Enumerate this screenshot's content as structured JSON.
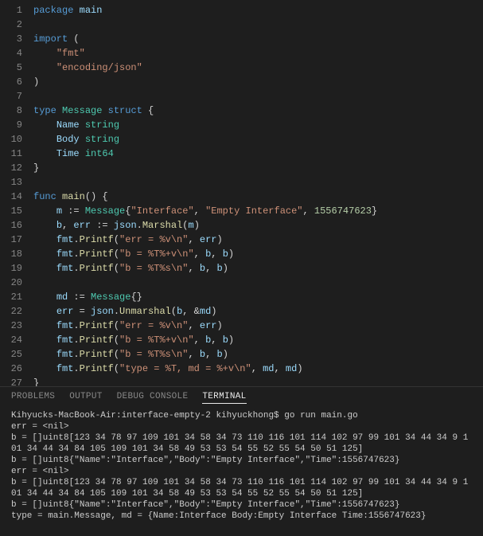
{
  "editor": {
    "lines": [
      {
        "n": 1,
        "tokens": [
          [
            "kw",
            "package"
          ],
          [
            "punc",
            " "
          ],
          [
            "pkg",
            "main"
          ]
        ]
      },
      {
        "n": 2,
        "tokens": []
      },
      {
        "n": 3,
        "tokens": [
          [
            "kw",
            "import"
          ],
          [
            "punc",
            " ("
          ]
        ]
      },
      {
        "n": 4,
        "tokens": [
          [
            "punc",
            "    "
          ],
          [
            "str",
            "\"fmt\""
          ]
        ]
      },
      {
        "n": 5,
        "tokens": [
          [
            "punc",
            "    "
          ],
          [
            "str",
            "\"encoding/json\""
          ]
        ]
      },
      {
        "n": 6,
        "tokens": [
          [
            "punc",
            ")"
          ]
        ]
      },
      {
        "n": 7,
        "tokens": []
      },
      {
        "n": 8,
        "tokens": [
          [
            "kw",
            "type"
          ],
          [
            "punc",
            " "
          ],
          [
            "type",
            "Message"
          ],
          [
            "punc",
            " "
          ],
          [
            "kw",
            "struct"
          ],
          [
            "punc",
            " {"
          ]
        ]
      },
      {
        "n": 9,
        "tokens": [
          [
            "punc",
            "    "
          ],
          [
            "var",
            "Name"
          ],
          [
            "punc",
            " "
          ],
          [
            "typekw",
            "string"
          ]
        ]
      },
      {
        "n": 10,
        "tokens": [
          [
            "punc",
            "    "
          ],
          [
            "var",
            "Body"
          ],
          [
            "punc",
            " "
          ],
          [
            "typekw",
            "string"
          ]
        ]
      },
      {
        "n": 11,
        "tokens": [
          [
            "punc",
            "    "
          ],
          [
            "var",
            "Time"
          ],
          [
            "punc",
            " "
          ],
          [
            "typekw",
            "int64"
          ]
        ]
      },
      {
        "n": 12,
        "tokens": [
          [
            "punc",
            "}"
          ]
        ]
      },
      {
        "n": 13,
        "tokens": []
      },
      {
        "n": 14,
        "tokens": [
          [
            "kw",
            "func"
          ],
          [
            "punc",
            " "
          ],
          [
            "fn",
            "main"
          ],
          [
            "punc",
            "() {"
          ]
        ]
      },
      {
        "n": 15,
        "tokens": [
          [
            "punc",
            "    "
          ],
          [
            "var",
            "m"
          ],
          [
            "punc",
            " := "
          ],
          [
            "type",
            "Message"
          ],
          [
            "punc",
            "{"
          ],
          [
            "str",
            "\"Interface\""
          ],
          [
            "punc",
            ", "
          ],
          [
            "str",
            "\"Empty Interface\""
          ],
          [
            "punc",
            ", "
          ],
          [
            "num",
            "1556747623"
          ],
          [
            "punc",
            "}"
          ]
        ]
      },
      {
        "n": 16,
        "tokens": [
          [
            "punc",
            "    "
          ],
          [
            "var",
            "b"
          ],
          [
            "punc",
            ", "
          ],
          [
            "var",
            "err"
          ],
          [
            "punc",
            " := "
          ],
          [
            "pkg",
            "json"
          ],
          [
            "punc",
            "."
          ],
          [
            "fn",
            "Marshal"
          ],
          [
            "punc",
            "("
          ],
          [
            "var",
            "m"
          ],
          [
            "punc",
            ")"
          ]
        ]
      },
      {
        "n": 17,
        "tokens": [
          [
            "punc",
            "    "
          ],
          [
            "pkg",
            "fmt"
          ],
          [
            "punc",
            "."
          ],
          [
            "fn",
            "Printf"
          ],
          [
            "punc",
            "("
          ],
          [
            "str",
            "\"err = %v\\n\""
          ],
          [
            "punc",
            ", "
          ],
          [
            "var",
            "err"
          ],
          [
            "punc",
            ")"
          ]
        ]
      },
      {
        "n": 18,
        "tokens": [
          [
            "punc",
            "    "
          ],
          [
            "pkg",
            "fmt"
          ],
          [
            "punc",
            "."
          ],
          [
            "fn",
            "Printf"
          ],
          [
            "punc",
            "("
          ],
          [
            "str",
            "\"b = %T%+v\\n\""
          ],
          [
            "punc",
            ", "
          ],
          [
            "var",
            "b"
          ],
          [
            "punc",
            ", "
          ],
          [
            "var",
            "b"
          ],
          [
            "punc",
            ")"
          ]
        ]
      },
      {
        "n": 19,
        "tokens": [
          [
            "punc",
            "    "
          ],
          [
            "pkg",
            "fmt"
          ],
          [
            "punc",
            "."
          ],
          [
            "fn",
            "Printf"
          ],
          [
            "punc",
            "("
          ],
          [
            "str",
            "\"b = %T%s\\n\""
          ],
          [
            "punc",
            ", "
          ],
          [
            "var",
            "b"
          ],
          [
            "punc",
            ", "
          ],
          [
            "var",
            "b"
          ],
          [
            "punc",
            ")"
          ]
        ]
      },
      {
        "n": 20,
        "tokens": []
      },
      {
        "n": 21,
        "tokens": [
          [
            "punc",
            "    "
          ],
          [
            "var",
            "md"
          ],
          [
            "punc",
            " := "
          ],
          [
            "type",
            "Message"
          ],
          [
            "punc",
            "{}"
          ]
        ]
      },
      {
        "n": 22,
        "tokens": [
          [
            "punc",
            "    "
          ],
          [
            "var",
            "err"
          ],
          [
            "punc",
            " = "
          ],
          [
            "pkg",
            "json"
          ],
          [
            "punc",
            "."
          ],
          [
            "fn",
            "Unmarshal"
          ],
          [
            "punc",
            "("
          ],
          [
            "var",
            "b"
          ],
          [
            "punc",
            ", &"
          ],
          [
            "var",
            "md"
          ],
          [
            "punc",
            ")"
          ]
        ]
      },
      {
        "n": 23,
        "tokens": [
          [
            "punc",
            "    "
          ],
          [
            "pkg",
            "fmt"
          ],
          [
            "punc",
            "."
          ],
          [
            "fn",
            "Printf"
          ],
          [
            "punc",
            "("
          ],
          [
            "str",
            "\"err = %v\\n\""
          ],
          [
            "punc",
            ", "
          ],
          [
            "var",
            "err"
          ],
          [
            "punc",
            ")"
          ]
        ]
      },
      {
        "n": 24,
        "tokens": [
          [
            "punc",
            "    "
          ],
          [
            "pkg",
            "fmt"
          ],
          [
            "punc",
            "."
          ],
          [
            "fn",
            "Printf"
          ],
          [
            "punc",
            "("
          ],
          [
            "str",
            "\"b = %T%+v\\n\""
          ],
          [
            "punc",
            ", "
          ],
          [
            "var",
            "b"
          ],
          [
            "punc",
            ", "
          ],
          [
            "var",
            "b"
          ],
          [
            "punc",
            ")"
          ]
        ]
      },
      {
        "n": 25,
        "tokens": [
          [
            "punc",
            "    "
          ],
          [
            "pkg",
            "fmt"
          ],
          [
            "punc",
            "."
          ],
          [
            "fn",
            "Printf"
          ],
          [
            "punc",
            "("
          ],
          [
            "str",
            "\"b = %T%s\\n\""
          ],
          [
            "punc",
            ", "
          ],
          [
            "var",
            "b"
          ],
          [
            "punc",
            ", "
          ],
          [
            "var",
            "b"
          ],
          [
            "punc",
            ")"
          ]
        ]
      },
      {
        "n": 26,
        "tokens": [
          [
            "punc",
            "    "
          ],
          [
            "pkg",
            "fmt"
          ],
          [
            "punc",
            "."
          ],
          [
            "fn",
            "Printf"
          ],
          [
            "punc",
            "("
          ],
          [
            "str",
            "\"type = %T, md = %+v\\n\""
          ],
          [
            "punc",
            ", "
          ],
          [
            "var",
            "md"
          ],
          [
            "punc",
            ", "
          ],
          [
            "var",
            "md"
          ],
          [
            "punc",
            ")"
          ]
        ]
      },
      {
        "n": 27,
        "tokens": [
          [
            "punc",
            "}"
          ]
        ]
      }
    ]
  },
  "panel": {
    "tabs": {
      "problems": "PROBLEMS",
      "output": "OUTPUT",
      "debug": "DEBUG CONSOLE",
      "terminal": "TERMINAL"
    },
    "terminal": {
      "prompt": "Kihyucks-MacBook-Air:interface-empty-2 kihyuckhong$ ",
      "command": "go run main.go",
      "output": [
        "err = <nil>",
        "b = []uint8[123 34 78 97 109 101 34 58 34 73 110 116 101 114 102 97 99 101 34 44 34 9 101 34 44 34 84 105 109 101 34 58 49 53 53 54 55 52 55 54 50 51 125]",
        "b = []uint8{\"Name\":\"Interface\",\"Body\":\"Empty Interface\",\"Time\":1556747623}",
        "err = <nil>",
        "b = []uint8[123 34 78 97 109 101 34 58 34 73 110 116 101 114 102 97 99 101 34 44 34 9 101 34 44 34 84 105 109 101 34 58 49 53 53 54 55 52 55 54 50 51 125]",
        "b = []uint8{\"Name\":\"Interface\",\"Body\":\"Empty Interface\",\"Time\":1556747623}",
        "type = main.Message, md = {Name:Interface Body:Empty Interface Time:1556747623}"
      ]
    }
  }
}
